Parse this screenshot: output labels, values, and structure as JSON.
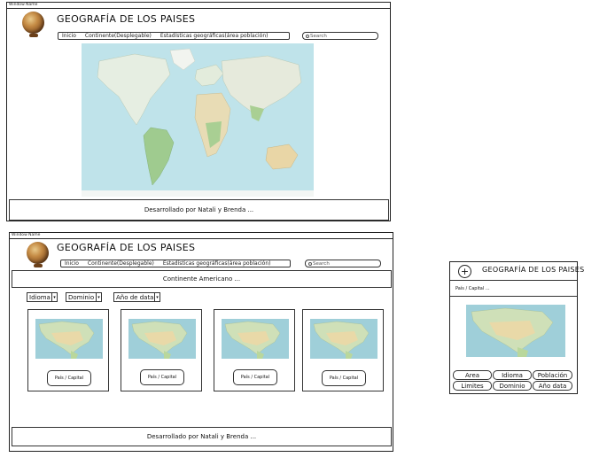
{
  "desktop_home": {
    "window_name": "Window Name",
    "title": "GEOGRAFÍA DE LOS PAISES",
    "nav": [
      "Inicio",
      "Continente(Desplegable)",
      "Estadísticas geográficas(área población)"
    ],
    "search_placeholder": "Search",
    "footer": "Desarrollado por Natali y Brenda ..."
  },
  "desktop_continent": {
    "window_name": "Window Name",
    "title": "GEOGRAFÍA DE LOS PAISES",
    "nav": [
      "Inicio",
      "Continente(Desplegable)",
      "Estadísticas geográficas(área población)"
    ],
    "search_placeholder": "Search",
    "section_title": "Continente Americano ...",
    "filters": [
      "Idioma",
      "Dominio",
      "Año de data"
    ],
    "cards": [
      {
        "button": "País / Capital"
      },
      {
        "button": "País / Capital"
      },
      {
        "button": "País / Capital"
      },
      {
        "button": "País / Capital"
      }
    ],
    "footer": "Desarrollado por Natali y Brenda ..."
  },
  "mobile": {
    "add_icon": "+",
    "title": "GEOGRAFÍA DE LOS PAISES",
    "subtitle": "País / Capital ...",
    "pills": [
      "Area",
      "Idioma",
      "Población",
      "Limites",
      "Dominio",
      "Año data"
    ]
  }
}
